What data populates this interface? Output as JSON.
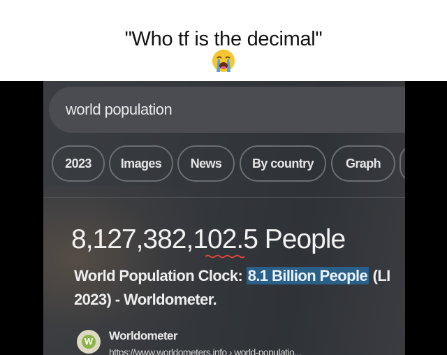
{
  "caption": "\"Who tf is the decimal\"",
  "emoji": "loudly-crying-face",
  "search": {
    "query": "world population"
  },
  "chips": [
    "2023",
    "Images",
    "News",
    "By country",
    "Graph"
  ],
  "result": {
    "count": "8,127,382,102.5 People",
    "description_before": "World Population Clock: ",
    "description_highlight": "8.1 Billion People",
    "description_after": " (LI",
    "description_line2": "2023) - Worldometer.",
    "source_name": "Worldometer",
    "source_url": "https://www.worldometers.info › world-populatio...",
    "source_icon_letter": "W"
  },
  "colors": {
    "screen_bg": "#34373c",
    "highlight": "#2a5f88",
    "squiggle": "#e0453a"
  }
}
